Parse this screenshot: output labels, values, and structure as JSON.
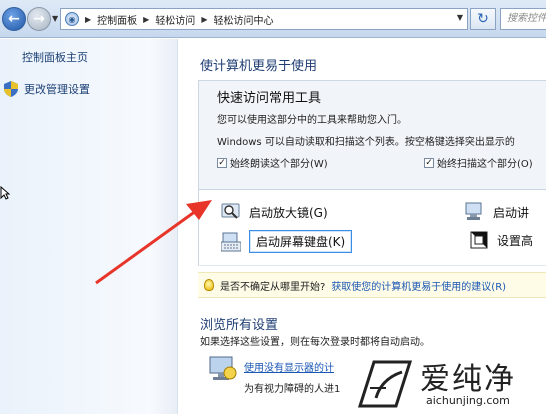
{
  "address_bar": {
    "breadcrumb": [
      "控制面板",
      "轻松访问",
      "轻松访问中心"
    ],
    "search_placeholder": "搜索控件"
  },
  "left_nav": {
    "home": "控制面板主页",
    "admin_settings": "更改管理设置"
  },
  "main": {
    "title": "使计算机更易于使用",
    "quick_access": {
      "heading": "快速访问常用工具",
      "desc1": "您可以使用这部分中的工具来帮助您入门。",
      "desc2": "Windows 可以自动读取和扫描这个列表。按空格键选择突出显示的",
      "check_read": "始终朗读这个部分(W)",
      "check_scan": "始终扫描这个部分(O)"
    },
    "tools": {
      "magnifier": "启动放大镜(G)",
      "onscreen_keyboard": "启动屏幕键盘(K)",
      "narrator": "启动讲",
      "high_contrast": "设置高"
    },
    "hint": {
      "question": "是否不确定从哪里开始?",
      "link": "获取使您的计算机更易于使用的建议(R)"
    },
    "browse": {
      "title": "浏览所有设置",
      "desc": "如果选择这些设置，则在每次登录时都将自动启动。",
      "no_display_link": "使用没有显示器的计",
      "no_display_desc": "为有视力障碍的人进1"
    }
  },
  "watermark": {
    "brand": "爱纯净",
    "url": "aichunjing.com"
  },
  "colors": {
    "annotation_arrow": "#e8352a",
    "link": "#1a57b4",
    "heading": "#1e3d73"
  },
  "icons": [
    "back-arrow-icon",
    "forward-arrow-icon",
    "control-panel-icon",
    "refresh-icon",
    "shield-icon",
    "magnifier-icon",
    "keyboard-icon",
    "narrator-icon",
    "high-contrast-icon",
    "lightbulb-icon",
    "monitor-icon",
    "cursor-icon"
  ]
}
